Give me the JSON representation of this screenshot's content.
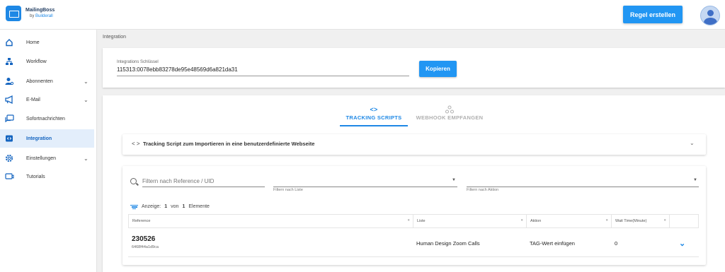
{
  "brand": {
    "name": "MailingBoss",
    "by": "by",
    "sub": "Builderall"
  },
  "header": {
    "create_rule_label": "Regel erstellen"
  },
  "sidebar": {
    "items": [
      {
        "label": "Home",
        "icon": "home-icon"
      },
      {
        "label": "Workflow",
        "icon": "workflow-icon"
      },
      {
        "label": "Abonnenten",
        "icon": "subscribers-icon",
        "expandable": true
      },
      {
        "label": "E-Mail",
        "icon": "megaphone-icon",
        "expandable": true
      },
      {
        "label": "Sofortnachrichten",
        "icon": "chat-icon"
      },
      {
        "label": "Integration",
        "icon": "code-icon",
        "active": true
      },
      {
        "label": "Einstellungen",
        "icon": "gear-icon",
        "expandable": true
      },
      {
        "label": "Tutorials",
        "icon": "tutorial-icon"
      }
    ]
  },
  "breadcrumb": "Integration",
  "integration_key": {
    "label": "Integrations Schlüssel",
    "value": "115313:0078ebb83278de95e48569d6a821da31",
    "copy_label": "Kopieren"
  },
  "tabs": [
    {
      "label": "TRACKING SCRIPTS",
      "active": true,
      "icon": "code-icon"
    },
    {
      "label": "WEBHOOK EMPFANGEN",
      "active": false,
      "icon": "webhook-icon"
    }
  ],
  "accordion": {
    "title": "Tracking Script zum Importieren in eine benutzerdefinierte Webseite"
  },
  "filters": {
    "search_placeholder": "Filtern nach Reference / UID",
    "list_hint": "Filtern nach Liste",
    "action_hint": "Filtern nach Aktion"
  },
  "count": {
    "prefix": "Anzeige:",
    "shown": "1",
    "of": "von",
    "total": "1",
    "suffix": "Elemente"
  },
  "table": {
    "columns": [
      "Reference",
      "Liste",
      "Aktion",
      "Wait Time(Minute)"
    ],
    "rows": [
      {
        "reference": "230526",
        "uid": "6468f44a1d9ca",
        "list": "Human Design Zoom Calls",
        "action": "TAG-Wert einfügen",
        "wait": "0"
      }
    ]
  },
  "colors": {
    "accent": "#2196f3",
    "active_bg": "#e3eefb",
    "background": "#f0f0f0"
  }
}
